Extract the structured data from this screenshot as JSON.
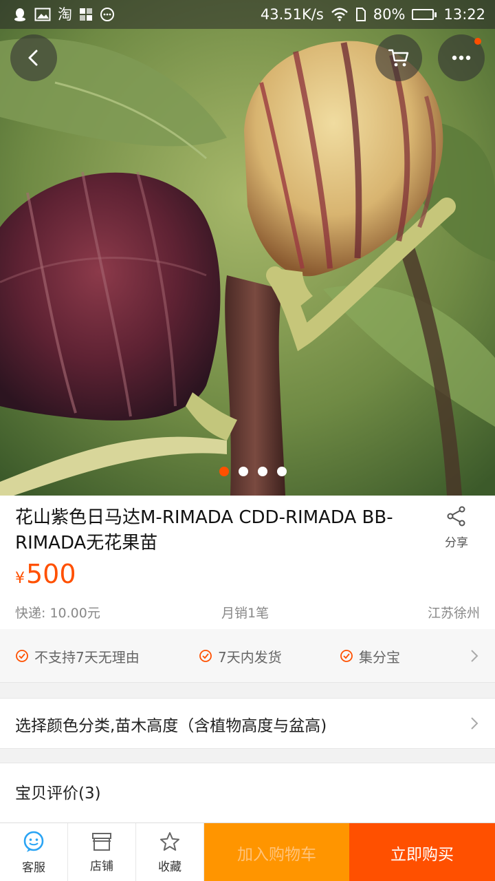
{
  "status_bar": {
    "left_icons": [
      "qq-icon",
      "image-icon",
      "taobao-icon",
      "apps-icon",
      "chat-icon"
    ],
    "taobao_glyph": "淘",
    "speed": "43.51K/s",
    "battery": "80%",
    "battery_level": 0.8,
    "time": "13:22"
  },
  "hero": {
    "icons": [
      "back-icon",
      "cart-icon",
      "more-icon"
    ],
    "carousel_total": 4,
    "carousel_active": 1
  },
  "product": {
    "title": "花山紫色日马达M-RIMADA CDD-RIMADA BB-RIMADA无花果苗",
    "share_label": "分享",
    "price_symbol": "¥",
    "price": "500",
    "shipping": "快递: 10.00元",
    "monthly_sales": "月销1笔",
    "location": "江苏徐州"
  },
  "guarantees": [
    {
      "label": "不支持7天无理由"
    },
    {
      "label": "7天内发货"
    },
    {
      "label": "集分宝"
    }
  ],
  "select_options": {
    "label": "选择颜色分类,苗木高度（含植物高度与盆高)"
  },
  "reviews": {
    "label": "宝贝评价(3)"
  },
  "bottom_bar": {
    "service_label": "客服",
    "store_label": "店铺",
    "favorite_label": "收藏",
    "add_to_cart_label": "加入购物车",
    "buy_now_label": "立即购买"
  },
  "colors": {
    "accent": "#ff5000",
    "add_cart": "#ff9500",
    "icon_blue": "#2aa4f4"
  }
}
